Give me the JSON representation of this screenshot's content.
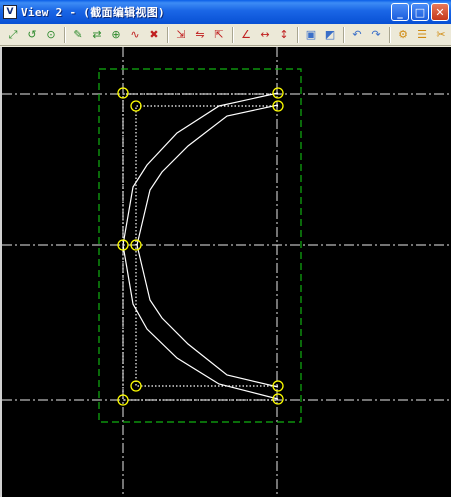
{
  "window": {
    "title": "View 2 - (截面编辑视图)",
    "icon_label": "V",
    "minimize_glyph": "_",
    "maximize_glyph": "□",
    "close_glyph": "✕"
  },
  "toolbar": {
    "groups": [
      [
        {
          "name": "zoom-fit-icon",
          "glyph": "⤢",
          "color": "#2c8a2c"
        },
        {
          "name": "rotate-view-icon",
          "glyph": "↺",
          "color": "#2c8a2c"
        },
        {
          "name": "zoom-window-icon",
          "glyph": "⊙",
          "color": "#2c8a2c"
        }
      ],
      [
        {
          "name": "add-point-icon",
          "glyph": "✎",
          "color": "#2c8a2c"
        },
        {
          "name": "move-point-icon",
          "glyph": "⇄",
          "color": "#2c8a2c"
        },
        {
          "name": "insert-point-icon",
          "glyph": "⊕",
          "color": "#2c8a2c"
        },
        {
          "name": "edit-curve-icon",
          "glyph": "∿",
          "color": "#c02020"
        },
        {
          "name": "delete-point-icon",
          "glyph": "✖",
          "color": "#c02020"
        }
      ],
      [
        {
          "name": "offset-icon",
          "glyph": "⇲",
          "color": "#c02020"
        },
        {
          "name": "mirror-icon",
          "glyph": "⇋",
          "color": "#c02020"
        },
        {
          "name": "align-icon",
          "glyph": "⇱",
          "color": "#c02020"
        }
      ],
      [
        {
          "name": "dimension-angle-icon",
          "glyph": "∠",
          "color": "#c02020"
        },
        {
          "name": "dimension-length-icon",
          "glyph": "↔",
          "color": "#c02020"
        },
        {
          "name": "dimension-vertical-icon",
          "glyph": "↕",
          "color": "#c02020"
        }
      ],
      [
        {
          "name": "save-section-icon",
          "glyph": "▣",
          "color": "#3a6fc8"
        },
        {
          "name": "load-section-icon",
          "glyph": "◩",
          "color": "#3a6fc8"
        }
      ],
      [
        {
          "name": "undo-icon",
          "glyph": "↶",
          "color": "#3a6fc8"
        },
        {
          "name": "redo-icon",
          "glyph": "↷",
          "color": "#3a6fc8"
        }
      ],
      [
        {
          "name": "settings-icon",
          "glyph": "⚙",
          "color": "#d08a10"
        },
        {
          "name": "layers-icon",
          "glyph": "☰",
          "color": "#d08a10"
        },
        {
          "name": "tools-icon",
          "glyph": "✂",
          "color": "#d08a10"
        }
      ]
    ]
  },
  "canvas": {
    "colors": {
      "background": "#000000",
      "centerline": "#e8e8e8",
      "boundary": "#10b010",
      "section": "#ffffff",
      "control_point": "#ffff00"
    }
  }
}
